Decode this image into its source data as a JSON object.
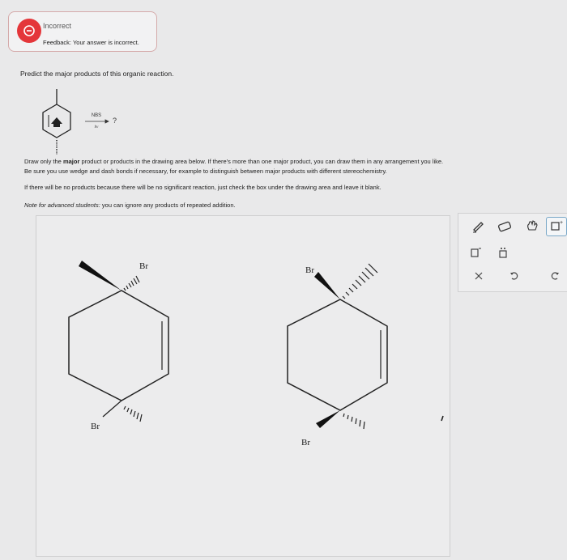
{
  "feedback": {
    "status": "Incorrect",
    "message": "Feedback: Your answer is incorrect."
  },
  "question": {
    "prompt": "Predict the major products of this organic reaction.",
    "reagent_top": "NBS",
    "reagent_bottom": "hν",
    "product_placeholder": "?"
  },
  "instructions": {
    "line1_pre": "Draw only the ",
    "line1_bold": "major",
    "line1_post": " product or products in the drawing area below. If there's more than one major product, you can draw them in any arrangement you like.",
    "line2": "Be sure you use wedge and dash bonds if necessary, for example to distinguish between major products with different stereochemistry.",
    "line3": "If there will be no products because there will be no significant reaction, just check the box under the drawing area and leave it blank.",
    "line4_label": "Note for advanced students:",
    "line4_text": " you can ignore any products of repeated addition."
  },
  "drawing": {
    "mol1": {
      "br_top": "Br",
      "br_bottom": "Br"
    },
    "mol2": {
      "br_top": "Br",
      "br_bottom": "Br"
    }
  },
  "toolbar": {
    "tools": [
      "pencil-icon",
      "eraser-icon",
      "hand-icon",
      "add-box-icon",
      "charge-box-icon",
      "lone-pair-icon",
      "clear-icon",
      "undo-icon",
      "redo-icon"
    ]
  }
}
